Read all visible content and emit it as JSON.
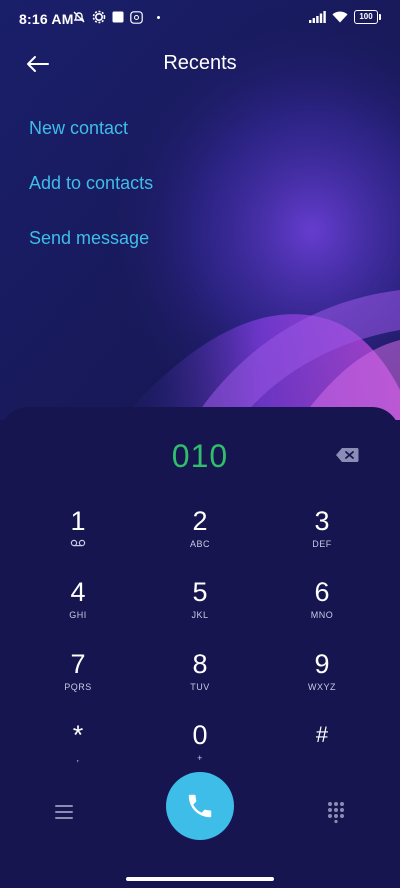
{
  "status_bar": {
    "time": "8:16 AM",
    "battery": "100",
    "icons_left": [
      "muted-bell-icon",
      "settings-gear-icon",
      "square-notification-icon",
      "app-badge-icon",
      "dot-icon"
    ],
    "icons_right": [
      "signal-icon",
      "wifi-icon",
      "battery-icon"
    ]
  },
  "header": {
    "title": "Recents",
    "back_icon": "arrow-left-icon"
  },
  "actions": {
    "new_contact": "New contact",
    "add_to_contacts": "Add to contacts",
    "send_message": "Send message"
  },
  "dialer": {
    "number": "010",
    "backspace_icon": "backspace-icon",
    "keys": [
      {
        "digit": "1",
        "letters": "ꝏ"
      },
      {
        "digit": "2",
        "letters": "ABC"
      },
      {
        "digit": "3",
        "letters": "DEF"
      },
      {
        "digit": "4",
        "letters": "GHI"
      },
      {
        "digit": "5",
        "letters": "JKL"
      },
      {
        "digit": "6",
        "letters": "MNO"
      },
      {
        "digit": "7",
        "letters": "PQRS"
      },
      {
        "digit": "8",
        "letters": "TUV"
      },
      {
        "digit": "9",
        "letters": "WXYZ"
      },
      {
        "digit": "*",
        "letters": ","
      },
      {
        "digit": "0",
        "letters": "+"
      },
      {
        "digit": "#",
        "letters": ""
      }
    ]
  },
  "bottom_bar": {
    "menu_icon": "menu-icon",
    "call_icon": "phone-icon",
    "dialpad_icon": "dialpad-icon"
  },
  "colors": {
    "background": "#16154f",
    "accent": "#3fbde9",
    "number": "#2fbf6a"
  }
}
